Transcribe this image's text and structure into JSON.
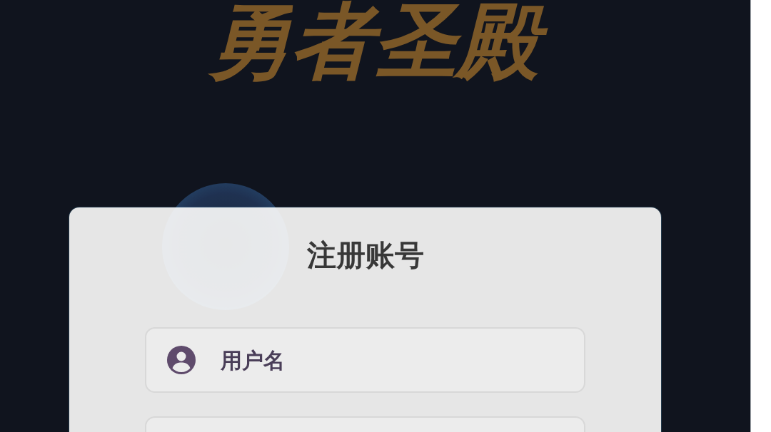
{
  "title": "勇者圣殿",
  "register_card": {
    "title": "注册账号",
    "fields": [
      {
        "kind": "username",
        "placeholder": "用户名"
      },
      {
        "kind": "input"
      }
    ]
  }
}
